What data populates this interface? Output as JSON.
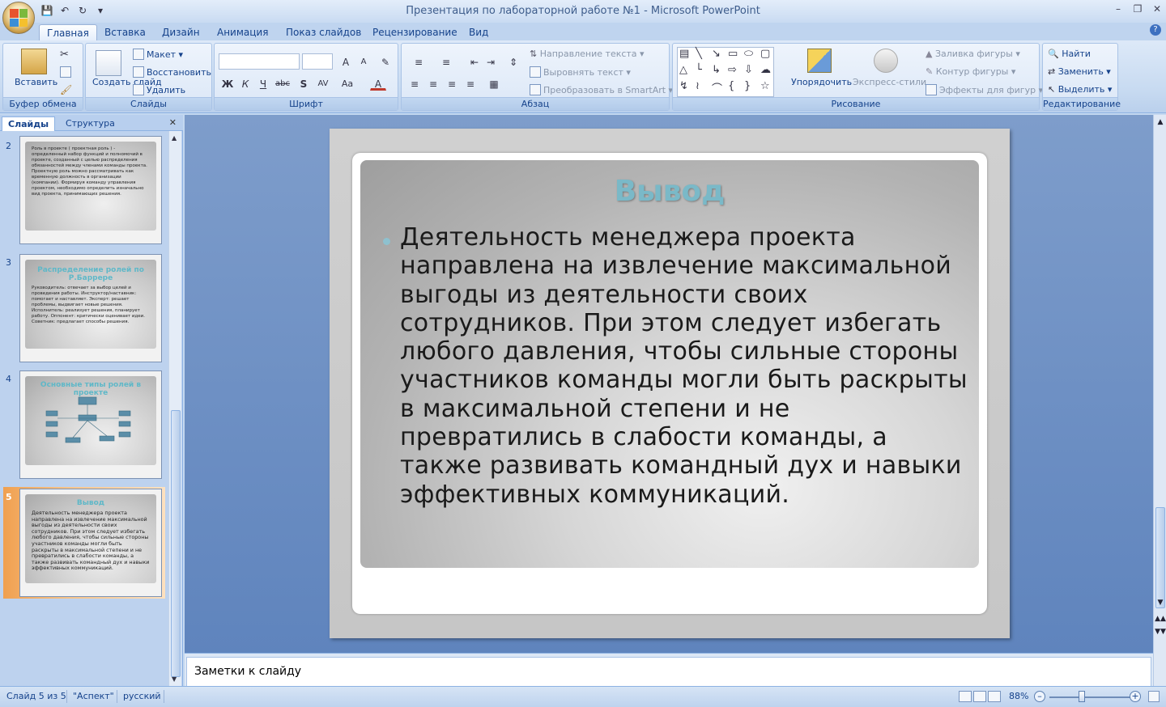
{
  "window": {
    "title": "Презентация по лабораторной работе №1 - Microsoft PowerPoint"
  },
  "ribbon_tabs": [
    "Главная",
    "Вставка",
    "Дизайн",
    "Анимация",
    "Показ слайдов",
    "Рецензирование",
    "Вид"
  ],
  "active_tab": "Главная",
  "ribbon": {
    "clipboard": {
      "label": "Буфер обмена",
      "paste": "Вставить"
    },
    "slides": {
      "label": "Слайды",
      "new_slide": "Создать слайд",
      "layout": "Макет",
      "reset": "Восстановить",
      "delete": "Удалить"
    },
    "font": {
      "label": "Шрифт",
      "bold": "Ж",
      "italic": "К",
      "underline": "Ч",
      "strike": "abc",
      "shadow": "S",
      "spacing": "AV",
      "case": "Aa",
      "color": "A",
      "grow": "A",
      "shrink": "A"
    },
    "paragraph": {
      "label": "Абзац",
      "text_direction": "Направление текста",
      "align_text": "Выровнять текст",
      "smartart": "Преобразовать в SmartArt"
    },
    "drawing": {
      "label": "Рисование",
      "arrange": "Упорядочить",
      "quick_styles": "Экспресс-стили",
      "fill": "Заливка фигуры",
      "outline": "Контур фигуры",
      "effects": "Эффекты для фигур"
    },
    "editing": {
      "label": "Редактирование",
      "find": "Найти",
      "replace": "Заменить",
      "select": "Выделить"
    }
  },
  "left_pane": {
    "tabs": [
      "Слайды",
      "Структура"
    ],
    "thumbnails": [
      {
        "number": "2",
        "title": "",
        "text": "Роль в проекте ( проектная роль ) - определенный набор функций и полномочий в проекте, созданный с целью распределения обязанностей между членами команды проекта. Проектную роль можно рассматривать как временную должность в организации (компании). Формируя команду управления проектом, необходимо определить изначально вид проекта, принимающих решения."
      },
      {
        "number": "3",
        "title": "Распределение ролей по Р.Баррере",
        "text": "Руководитель: отвечает за выбор целей и проведения работы. Инструктор/наставник: помогает и наставляет. Эксперт: решает проблемы, выдвигает новые решения. Исполнитель: реализует решения, планирует работу. Оппонент: критически оценивает идеи. Советник: предлагает способы решения."
      },
      {
        "number": "4",
        "title": "Основные типы ролей в проекте",
        "text": ""
      },
      {
        "number": "5",
        "title": "Вывод",
        "text": "Деятельность менеджера проекта направлена на извлечение максимальной выгоды из деятельности своих сотрудников. При этом следует избегать любого давления, чтобы сильные стороны участников команды могли быть раскрыты в максимальной степени и  не превратились в слабости команды, а также развивать  командный дух и навыки эффективных коммуникаций."
      }
    ],
    "selected": "5"
  },
  "slide": {
    "title": "Вывод",
    "body": "Деятельность менеджера проекта направлена на извлечение максимальной выгоды из деятельности своих сотрудников. При этом следует избегать любого давления, чтобы сильные стороны участников команды могли быть раскрыты в максимальной степени и  не превратились в слабости команды, а также развивать  командный дух и навыки эффективных коммуникаций."
  },
  "notes": {
    "placeholder": "Заметки к слайду"
  },
  "status": {
    "slide_counter": "Слайд 5 из 5",
    "theme": "\"Аспект\"",
    "language": "русский",
    "zoom": "88%"
  },
  "colors": {
    "accent": "#15428b",
    "slide_title": "#7ab9c8",
    "selected_thumb": "#f29a3a"
  }
}
